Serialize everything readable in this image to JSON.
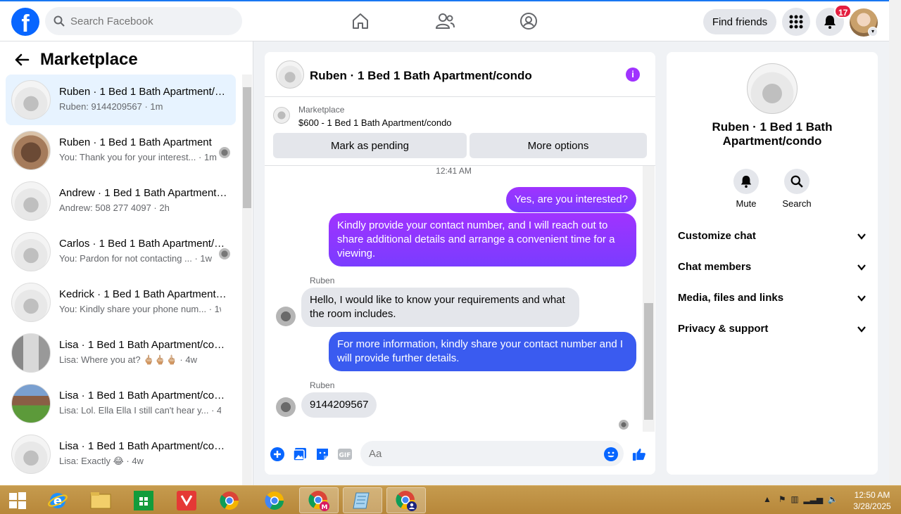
{
  "topbar": {
    "logo": "f",
    "search_placeholder": "Search Facebook",
    "find_friends": "Find friends",
    "notif_count": "17"
  },
  "marketplace": {
    "title": "Marketplace",
    "conversations": [
      {
        "name": "Ruben · 1 Bed 1 Bath Apartment/condo",
        "preview": "Ruben: 9144209567 · 1m"
      },
      {
        "name": "Ruben · 1 Bed 1 Bath Apartment",
        "preview": "You: Thank you for your interest... · 1m"
      },
      {
        "name": "Andrew · 1 Bed 1 Bath Apartment/condo",
        "preview": "Andrew: 508 277 4097 · 2h"
      },
      {
        "name": "Carlos · 1 Bed 1 Bath Apartment/condo",
        "preview": "You: Pardon for not contacting ... · 1w"
      },
      {
        "name": "Kedrick · 1 Bed 1 Bath Apartment/condo",
        "preview": "You: Kindly share your phone num... · 1w"
      },
      {
        "name": "Lisa · 1 Bed 1 Bath Apartment/condo",
        "preview": "Lisa: Where you at? 🖕🏼🖕🏼🖕🏼 · 4w"
      },
      {
        "name": "Lisa · 1 Bed 1 Bath Apartment/condo",
        "preview": "Lisa: Lol. Ella Ella I still can't hear y... · 4w"
      },
      {
        "name": "Lisa · 1 Bed 1 Bath Apartment/condo",
        "preview": "Lisa: Exactly 😂 · 4w"
      }
    ]
  },
  "chat": {
    "title": "Ruben · 1 Bed 1 Bath Apartment/condo",
    "listing_label": "Marketplace",
    "listing_price": "$600 - 1 Bed 1 Bath Apartment/condo",
    "mark_pending": "Mark as pending",
    "more_options": "More options",
    "time": "12:41 AM",
    "messages": [
      "Yes, are you interested?",
      "Kindly provide your contact number, and I will reach out to share additional details and arrange a convenient time for a viewing.",
      "Hello, I would like to know your requirements and what the room includes.",
      "For more information, kindly share your contact number and I will provide further details.",
      "9144209567"
    ],
    "sender": "Ruben",
    "composer_placeholder": "Aa"
  },
  "details": {
    "name": "Ruben · 1 Bed 1 Bath Apartment/condo",
    "mute": "Mute",
    "search": "Search",
    "sections": [
      "Customize chat",
      "Chat members",
      "Media, files and links",
      "Privacy & support"
    ]
  },
  "taskbar": {
    "time": "12:50 AM",
    "date": "3/28/2025"
  },
  "colors": {
    "brand": "#0866ff",
    "outgoing": "#7a3cff",
    "outgoing_blue": "#3a5bf0",
    "badge": "#e41e3f"
  }
}
